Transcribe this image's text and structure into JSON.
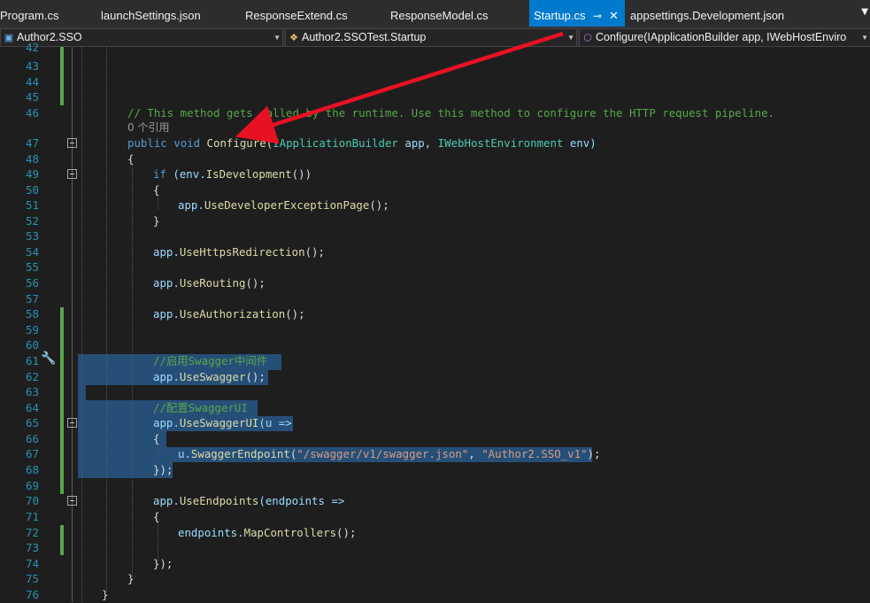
{
  "tabs": [
    {
      "label": "Program.cs",
      "active": false
    },
    {
      "label": "launchSettings.json",
      "active": false
    },
    {
      "label": "ResponseExtend.cs",
      "active": false
    },
    {
      "label": "ResponseModel.cs",
      "active": false
    },
    {
      "label": "Startup.cs",
      "active": true
    },
    {
      "label": "appsettings.Development.json",
      "active": false
    }
  ],
  "nav": {
    "project": "Author2.SSO",
    "class": "Author2.SSOTest.Startup",
    "member": "Configure(IApplicationBuilder app, IWebHostEnviro"
  },
  "codelens": "0 个引用",
  "lines": [
    {
      "n": "42"
    },
    {
      "n": "43"
    },
    {
      "n": "44"
    },
    {
      "n": "45"
    },
    {
      "n": "46"
    },
    {
      "n": ""
    },
    {
      "n": "47"
    },
    {
      "n": "48"
    },
    {
      "n": "49"
    },
    {
      "n": "50"
    },
    {
      "n": "51"
    },
    {
      "n": "52"
    },
    {
      "n": "53"
    },
    {
      "n": "54"
    },
    {
      "n": "55"
    },
    {
      "n": "56"
    },
    {
      "n": "57"
    },
    {
      "n": "58"
    },
    {
      "n": "59"
    },
    {
      "n": "60"
    },
    {
      "n": "61"
    },
    {
      "n": "62"
    },
    {
      "n": "63"
    },
    {
      "n": "64"
    },
    {
      "n": "65"
    },
    {
      "n": "66"
    },
    {
      "n": "67"
    },
    {
      "n": "68"
    },
    {
      "n": "69"
    },
    {
      "n": "70"
    },
    {
      "n": "71"
    },
    {
      "n": "72"
    },
    {
      "n": "73"
    },
    {
      "n": "74"
    },
    {
      "n": "75"
    },
    {
      "n": "76"
    }
  ],
  "code": {
    "l46": "// This method gets called by the runtime. Use this method to configure the HTTP request pipeline.",
    "l47_kw1": "public",
    "l47_kw2": "void",
    "l47_method": "Configure",
    "l47_rest1": "(",
    "l47_type1": "IApplicationBuilder",
    "l47_p1": " app, ",
    "l47_type2": "IWebHostEnvironment",
    "l47_p2": " env)",
    "l48": "{",
    "l49_kw": "if",
    "l49_rest": " (env.",
    "l49_mth": "IsDevelopment",
    "l49_end": "())",
    "l50": "{",
    "l51_a": "app.",
    "l51_m": "UseDeveloperExceptionPage",
    "l51_e": "();",
    "l52": "}",
    "l54_a": "app.",
    "l54_m": "UseHttpsRedirection",
    "l54_e": "();",
    "l56_a": "app.",
    "l56_m": "UseRouting",
    "l56_e": "();",
    "l58_a": "app.",
    "l58_m": "UseAuthorization",
    "l58_e": "();",
    "l61": "//启用Swagger中间件",
    "l62_a": "app.",
    "l62_m": "UseSwagger",
    "l62_e": "();",
    "l64": "//配置SwaggerUI",
    "l65_a": "app.",
    "l65_m": "UseSwaggerUI",
    "l65_e": "(u =>",
    "l66": "{",
    "l67_a": "u.",
    "l67_m": "SwaggerEndpoint",
    "l67_b": "(",
    "l67_s1": "\"/swagger/v1/swagger.json\"",
    "l67_c": ", ",
    "l67_s2": "\"Author2.SSO_v1\"",
    "l67_e": ");",
    "l68": "});",
    "l70_a": "app.",
    "l70_m": "UseEndpoints",
    "l70_e": "(endpoints =>",
    "l71": "{",
    "l72_a": "endpoints.",
    "l72_m": "MapControllers",
    "l72_e": "();",
    "l74": "});",
    "l75": "}",
    "l76": "}"
  },
  "colors": {
    "accent": "#007acc",
    "annotation_arrow": "#e81123"
  }
}
